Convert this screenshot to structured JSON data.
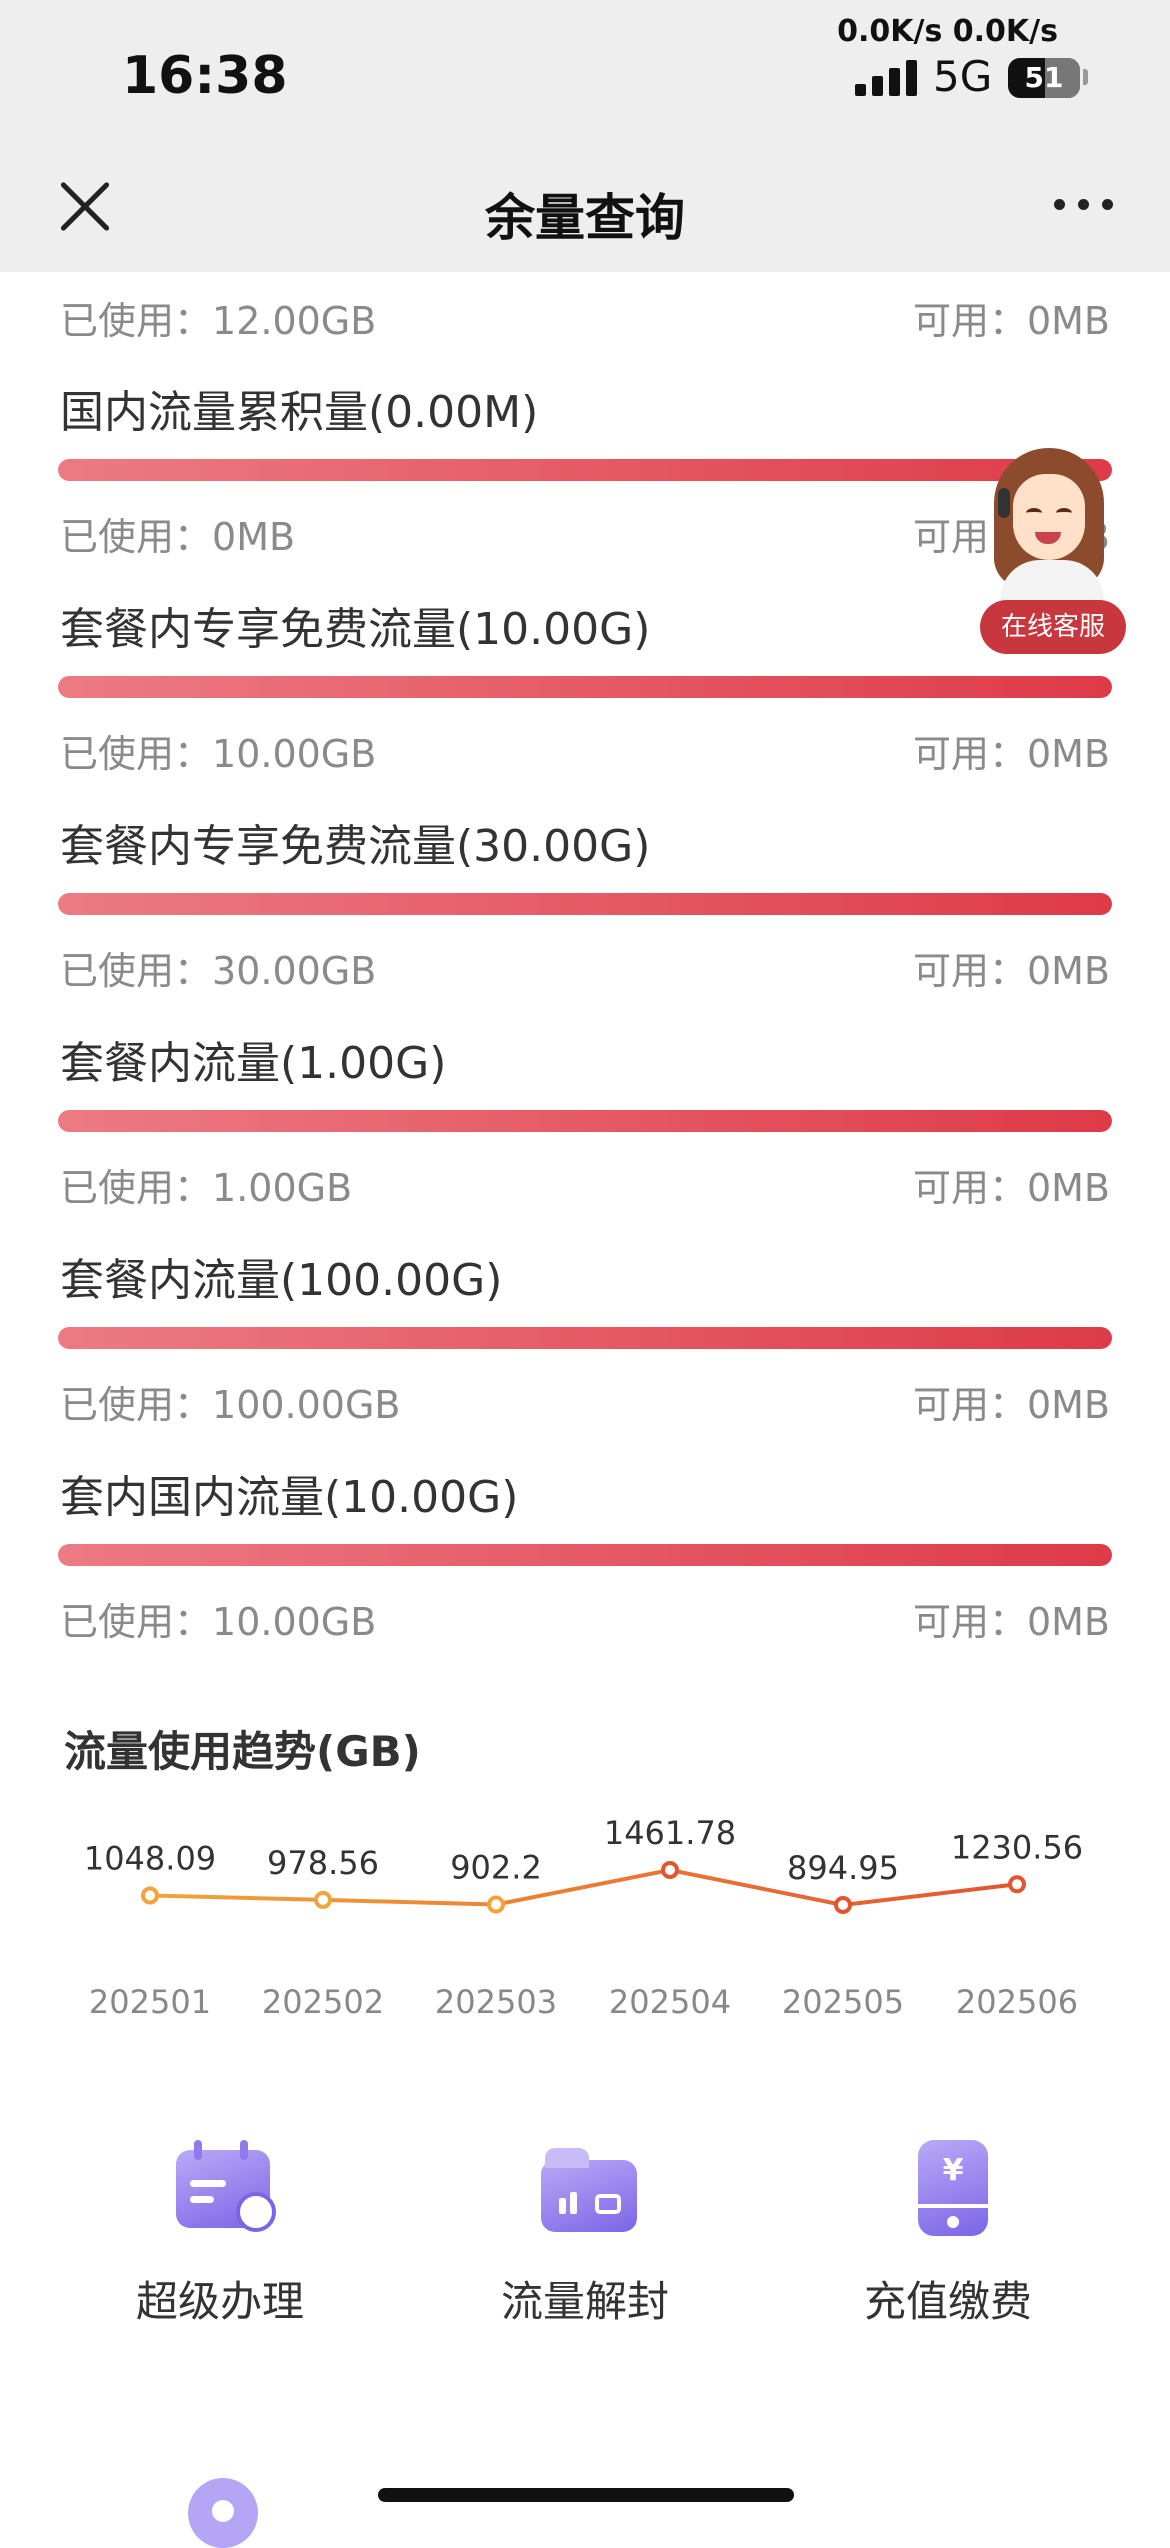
{
  "status_bar": {
    "time": "16:38",
    "net_speed": "0.0K/s 0.0K/s",
    "network": "5G",
    "battery": "51",
    "battery_level": 0.51
  },
  "header": {
    "title": "余量查询"
  },
  "usage": {
    "used_prefix": "已使用：",
    "avail_prefix": "可用：",
    "top_used": "12.00GB",
    "top_avail": "0MB",
    "items": [
      {
        "title": "国内流量累积量(0.00M)",
        "used": "0MB",
        "avail": "0MB",
        "fill": 1.0
      },
      {
        "title": "套餐内专享免费流量(10.00G)",
        "used": "10.00GB",
        "avail": "0MB",
        "fill": 1.0
      },
      {
        "title": "套餐内专享免费流量(30.00G)",
        "used": "30.00GB",
        "avail": "0MB",
        "fill": 1.0
      },
      {
        "title": "套餐内流量(1.00G)",
        "used": "1.00GB",
        "avail": "0MB",
        "fill": 1.0
      },
      {
        "title": "套餐内流量(100.00G)",
        "used": "100.00GB",
        "avail": "0MB",
        "fill": 1.0
      },
      {
        "title": "套内国内流量(10.00G)",
        "used": "10.00GB",
        "avail": "0MB",
        "fill": 1.0
      }
    ]
  },
  "service_badge": "在线客服",
  "chart_title": "流量使用趋势(GB)",
  "chart_data": {
    "type": "line",
    "title": "流量使用趋势(GB)",
    "categories": [
      "202501",
      "202502",
      "202503",
      "202504",
      "202505",
      "202506"
    ],
    "values": [
      1048.09,
      978.56,
      902.2,
      1461.78,
      894.95,
      1230.56
    ],
    "value_labels": [
      "1048.09",
      "978.56",
      "902.2",
      "1461.78",
      "894.95",
      "1230.56"
    ],
    "grid": false,
    "colors": [
      "#f2a33a",
      "#e2552f"
    ]
  },
  "actions": [
    {
      "label": "超级办理",
      "icon": "calendar-clock-icon"
    },
    {
      "label": "流量解封",
      "icon": "folder-lock-icon"
    },
    {
      "label": "充值缴费",
      "icon": "phone-yuan-icon"
    }
  ]
}
